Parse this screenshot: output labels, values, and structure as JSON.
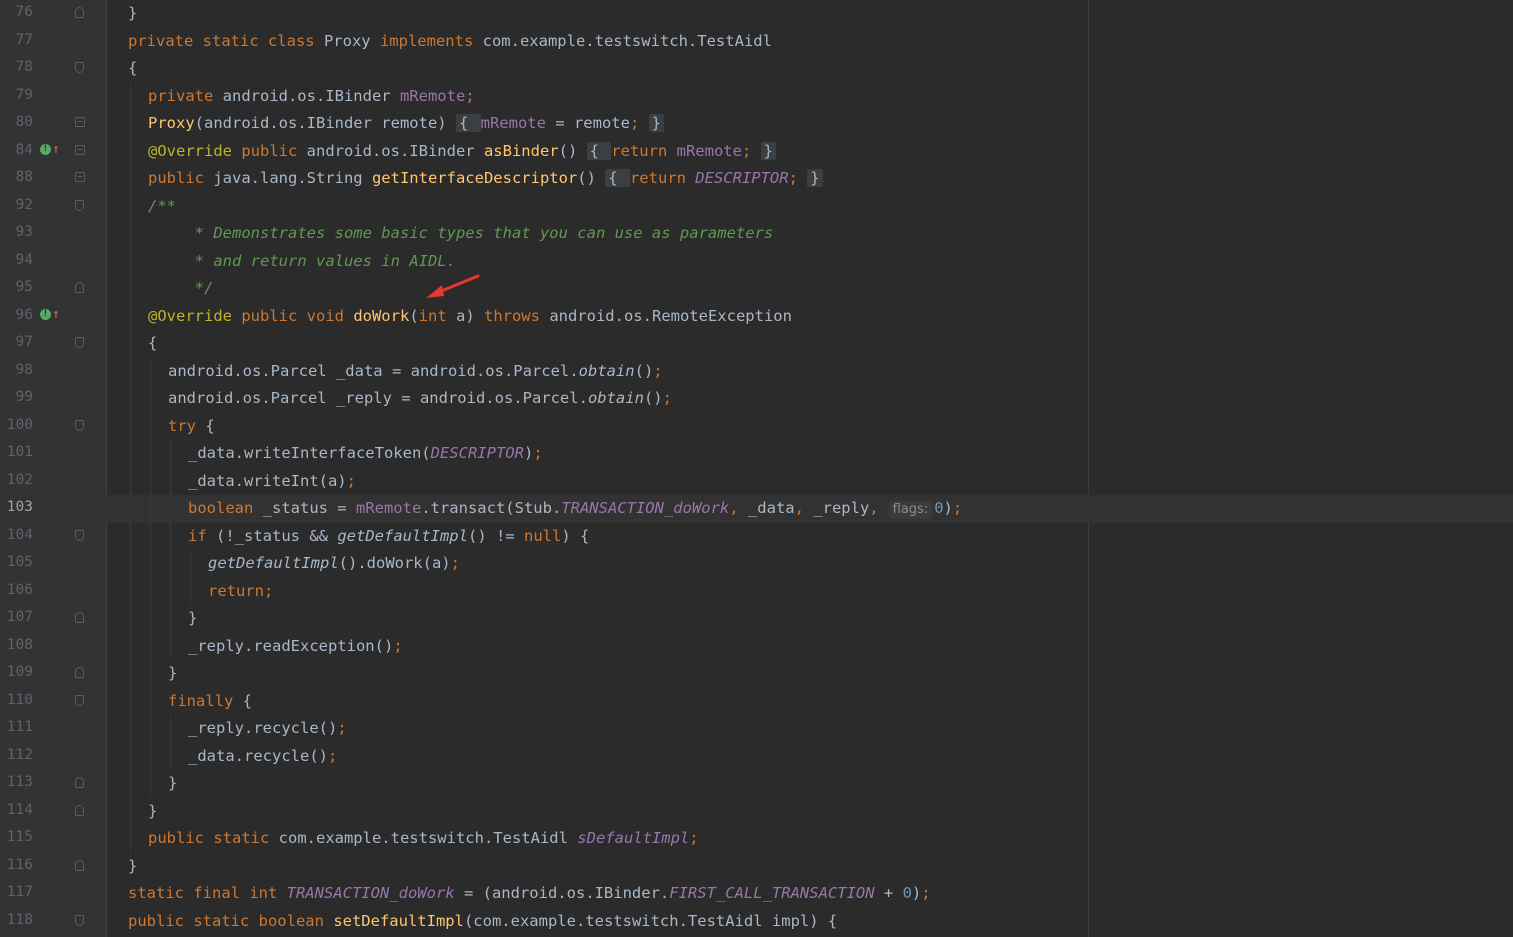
{
  "editor": {
    "inlay_hint": "flags:",
    "lines": [
      {
        "n": "76",
        "indent": 0,
        "fold": "end",
        "tokens": [
          [
            "}",
            ""
          ]
        ]
      },
      {
        "n": "77",
        "indent": 0,
        "tokens": [
          [
            "private static class ",
            "kw"
          ],
          [
            "Proxy ",
            ""
          ],
          [
            "implements ",
            "kw"
          ],
          [
            "com.example.testswitch.TestAidl",
            ""
          ]
        ]
      },
      {
        "n": "78",
        "indent": 0,
        "fold": "start",
        "tokens": [
          [
            "{",
            ""
          ]
        ]
      },
      {
        "n": "79",
        "indent": 1,
        "tokens": [
          [
            "private ",
            "kw"
          ],
          [
            "android.os.IBinder ",
            ""
          ],
          [
            "mRemote",
            "fld"
          ],
          [
            ";",
            "kw"
          ]
        ]
      },
      {
        "n": "80",
        "indent": 1,
        "fold": "box",
        "tokens": [
          [
            "Proxy",
            "fn"
          ],
          [
            "(android.os.IBinder remote) ",
            ""
          ],
          [
            "{ ",
            "fblk"
          ],
          [
            "mRemote",
            "fld"
          ],
          [
            " = remote",
            ""
          ],
          [
            "; ",
            "kw"
          ],
          [
            "}",
            "fblk"
          ]
        ]
      },
      {
        "n": "84",
        "indent": 1,
        "fold": "box",
        "icon": true,
        "tokens": [
          [
            "@Override ",
            "ann"
          ],
          [
            "public ",
            "kw"
          ],
          [
            "android.os.IBinder ",
            ""
          ],
          [
            "asBinder",
            "fn"
          ],
          [
            "() ",
            ""
          ],
          [
            "{ ",
            "fblk"
          ],
          [
            "return ",
            "kw"
          ],
          [
            "mRemote",
            "fld"
          ],
          [
            "; ",
            "kw"
          ],
          [
            "}",
            "fblk"
          ]
        ]
      },
      {
        "n": "88",
        "indent": 1,
        "fold": "box",
        "tokens": [
          [
            "public ",
            "kw"
          ],
          [
            "java.lang.String ",
            ""
          ],
          [
            "getInterfaceDescriptor",
            "fn"
          ],
          [
            "() ",
            ""
          ],
          [
            "{ ",
            "fblk"
          ],
          [
            "return ",
            "kw"
          ],
          [
            "DESCRIPTOR",
            "sf"
          ],
          [
            "; ",
            "kw"
          ],
          [
            "}",
            "fblk"
          ]
        ]
      },
      {
        "n": "92",
        "indent": 1,
        "fold": "start",
        "tokens": [
          [
            "/**",
            "cmt"
          ]
        ]
      },
      {
        "n": "93",
        "indent": 1,
        "pad": "     ",
        "tokens": [
          [
            "* Demonstrates some basic types that you can use as parameters",
            "cmt"
          ]
        ]
      },
      {
        "n": "94",
        "indent": 1,
        "pad": "     ",
        "tokens": [
          [
            "* and return values in AIDL.",
            "cmt"
          ]
        ]
      },
      {
        "n": "95",
        "indent": 1,
        "pad": "     ",
        "fold": "end",
        "tokens": [
          [
            "*/",
            "cmt"
          ]
        ]
      },
      {
        "n": "96",
        "indent": 1,
        "icon": true,
        "tokens": [
          [
            "@Override ",
            "ann"
          ],
          [
            "public void ",
            "kw"
          ],
          [
            "doWork",
            "fn"
          ],
          [
            "(",
            ""
          ],
          [
            "int ",
            "kw"
          ],
          [
            "a) ",
            ""
          ],
          [
            "throws ",
            "kw"
          ],
          [
            "android.os.RemoteException",
            ""
          ]
        ]
      },
      {
        "n": "97",
        "indent": 1,
        "fold": "start",
        "tokens": [
          [
            "{",
            ""
          ]
        ]
      },
      {
        "n": "98",
        "indent": 2,
        "tokens": [
          [
            "android.os.Parcel _data = android.os.Parcel.",
            ""
          ],
          [
            "obtain",
            "ital"
          ],
          [
            "()",
            ""
          ],
          [
            ";",
            "kw"
          ]
        ]
      },
      {
        "n": "99",
        "indent": 2,
        "tokens": [
          [
            "android.os.Parcel _reply = android.os.Parcel.",
            ""
          ],
          [
            "obtain",
            "ital"
          ],
          [
            "()",
            ""
          ],
          [
            ";",
            "kw"
          ]
        ]
      },
      {
        "n": "100",
        "indent": 2,
        "fold": "start",
        "tokens": [
          [
            "try ",
            "kw"
          ],
          [
            "{",
            ""
          ]
        ]
      },
      {
        "n": "101",
        "indent": 3,
        "tokens": [
          [
            "_data.writeInterfaceToken(",
            ""
          ],
          [
            "DESCRIPTOR",
            "sf"
          ],
          [
            ")",
            ""
          ],
          [
            ";",
            "kw"
          ]
        ]
      },
      {
        "n": "102",
        "indent": 3,
        "tokens": [
          [
            "_data.writeInt(a)",
            ""
          ],
          [
            ";",
            "kw"
          ]
        ]
      },
      {
        "n": "103",
        "indent": 3,
        "current": true,
        "tokens": [
          [
            "boolean ",
            "kw"
          ],
          [
            "_status = ",
            ""
          ],
          [
            "mRemote",
            "fld"
          ],
          [
            ".transact(Stub.",
            ""
          ],
          [
            "TRANSACTION_doWork",
            "sf"
          ],
          [
            ", ",
            "kw"
          ],
          [
            "_data",
            ""
          ],
          [
            ", ",
            "kw"
          ],
          [
            "_reply",
            ""
          ],
          [
            ",",
            "kw"
          ],
          [
            "@HINT",
            ""
          ],
          [
            "0",
            "num"
          ],
          [
            ")",
            ""
          ],
          [
            ";",
            "kw"
          ]
        ]
      },
      {
        "n": "104",
        "indent": 3,
        "fold": "start",
        "tokens": [
          [
            "if ",
            "kw"
          ],
          [
            "(!_status && ",
            ""
          ],
          [
            "getDefaultImpl",
            "ital"
          ],
          [
            "() != ",
            ""
          ],
          [
            "null",
            "kw"
          ],
          [
            ") {",
            ""
          ]
        ]
      },
      {
        "n": "105",
        "indent": 4,
        "tokens": [
          [
            "getDefaultImpl",
            "ital"
          ],
          [
            "().doWork(a)",
            ""
          ],
          [
            ";",
            "kw"
          ]
        ]
      },
      {
        "n": "106",
        "indent": 4,
        "tokens": [
          [
            "return",
            "kw"
          ],
          [
            ";",
            "kw"
          ]
        ]
      },
      {
        "n": "107",
        "indent": 3,
        "fold": "end",
        "tokens": [
          [
            "}",
            ""
          ]
        ]
      },
      {
        "n": "108",
        "indent": 3,
        "tokens": [
          [
            "_reply.readException()",
            ""
          ],
          [
            ";",
            "kw"
          ]
        ]
      },
      {
        "n": "109",
        "indent": 2,
        "fold": "end",
        "tokens": [
          [
            "}",
            ""
          ]
        ]
      },
      {
        "n": "110",
        "indent": 2,
        "fold": "start",
        "tokens": [
          [
            "finally ",
            "kw"
          ],
          [
            "{",
            ""
          ]
        ]
      },
      {
        "n": "111",
        "indent": 3,
        "tokens": [
          [
            "_reply.recycle()",
            ""
          ],
          [
            ";",
            "kw"
          ]
        ]
      },
      {
        "n": "112",
        "indent": 3,
        "tokens": [
          [
            "_data.recycle()",
            ""
          ],
          [
            ";",
            "kw"
          ]
        ]
      },
      {
        "n": "113",
        "indent": 2,
        "fold": "end",
        "tokens": [
          [
            "}",
            ""
          ]
        ]
      },
      {
        "n": "114",
        "indent": 1,
        "fold": "end",
        "tokens": [
          [
            "}",
            ""
          ]
        ]
      },
      {
        "n": "115",
        "indent": 1,
        "tokens": [
          [
            "public static ",
            "kw"
          ],
          [
            "com.example.testswitch.TestAidl ",
            ""
          ],
          [
            "sDefaultImpl",
            "sf"
          ],
          [
            ";",
            "kw"
          ]
        ]
      },
      {
        "n": "116",
        "indent": 0,
        "fold": "end",
        "tokens": [
          [
            "}",
            ""
          ]
        ]
      },
      {
        "n": "117",
        "indent": 0,
        "tokens": [
          [
            "static final int ",
            "kw"
          ],
          [
            "TRANSACTION_doWork",
            "sf"
          ],
          [
            " = (android.os.IBinder.",
            ""
          ],
          [
            "FIRST_CALL_TRANSACTION",
            "sf"
          ],
          [
            " + ",
            ""
          ],
          [
            "0",
            "num"
          ],
          [
            ")",
            ""
          ],
          [
            ";",
            "kw"
          ]
        ]
      },
      {
        "n": "118",
        "indent": 0,
        "fold": "start",
        "tokens": [
          [
            "public static boolean ",
            "kw"
          ],
          [
            "setDefaultImpl",
            "fn"
          ],
          [
            "(com.example.testswitch.TestAidl impl) {",
            ""
          ]
        ]
      }
    ]
  },
  "colors": {
    "background": "#2b2b2b",
    "keyword": "#cc7832",
    "field": "#9876aa",
    "method": "#ffc66d",
    "annotation": "#bbb529",
    "comment": "#629755",
    "number": "#6897bb",
    "text": "#a9b7c6",
    "arrow": "#e8372c"
  }
}
